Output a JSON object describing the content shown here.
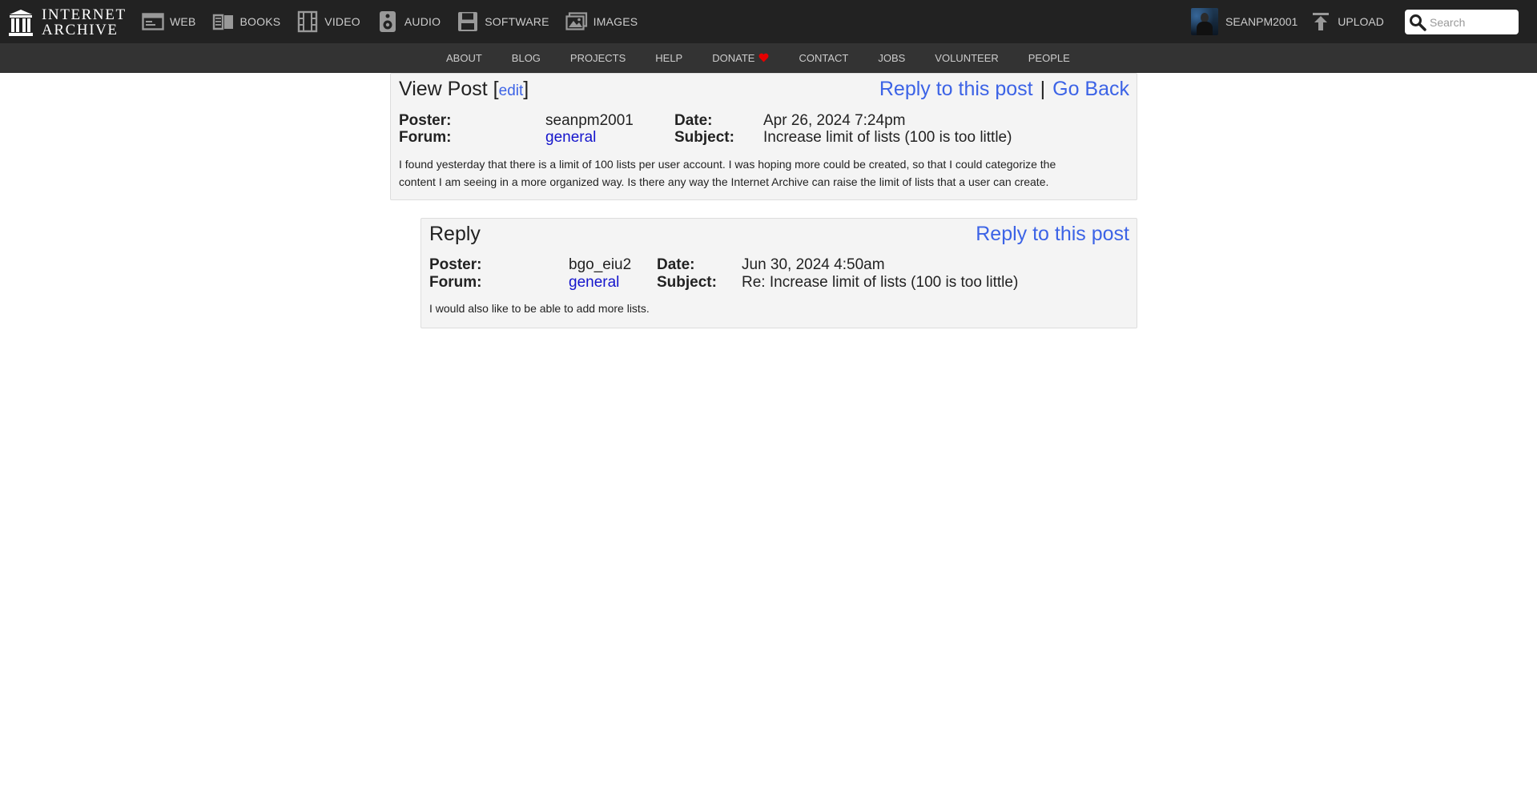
{
  "header": {
    "logo_line1": "INTERNET",
    "logo_line2": "ARCHIVE",
    "media_items": [
      {
        "label": "WEB",
        "icon": "web-icon"
      },
      {
        "label": "BOOKS",
        "icon": "books-icon"
      },
      {
        "label": "VIDEO",
        "icon": "video-icon"
      },
      {
        "label": "AUDIO",
        "icon": "audio-icon"
      },
      {
        "label": "SOFTWARE",
        "icon": "software-icon"
      },
      {
        "label": "IMAGES",
        "icon": "images-icon"
      }
    ],
    "username": "SEANPM2001",
    "upload_label": "UPLOAD",
    "search_placeholder": "Search"
  },
  "subnav": {
    "items": [
      "ABOUT",
      "BLOG",
      "PROJECTS",
      "HELP",
      "DONATE",
      "CONTACT",
      "JOBS",
      "VOLUNTEER",
      "PEOPLE"
    ],
    "donate_icon": "heart-icon",
    "heart_color": "#e50000"
  },
  "post": {
    "title": "View Post",
    "edit_label": "edit",
    "reply_link": "Reply to this post",
    "separator": "|",
    "back_link": "Go Back",
    "poster_label": "Poster:",
    "poster": "seanpm2001",
    "forum_label": "Forum:",
    "forum": "general",
    "date_label": "Date:",
    "date": "Apr 26, 2024 7:24pm",
    "subject_label": "Subject:",
    "subject": "Increase limit of lists (100 is too little)",
    "body_line1": "I found yesterday that there is a limit of 100 lists per user account. I was hoping more could be created, so that I could categorize the",
    "body_line2": "content I am seeing in a more organized way. Is there any way the Internet Archive can raise the limit of lists that a user can create."
  },
  "reply": {
    "title": "Reply",
    "reply_link": "Reply to this post",
    "poster_label": "Poster:",
    "poster": "bgo_eiu2",
    "forum_label": "Forum:",
    "forum": "general",
    "date_label": "Date:",
    "date": "Jun 30, 2024 4:50am",
    "subject_label": "Subject:",
    "subject": "Re: Increase limit of lists (100 is too little)",
    "body": "I would also like to be able to add more lists."
  },
  "colors": {
    "topbar": "#222222",
    "subnav": "#333333",
    "link_blue": "#3c63e6",
    "forum_link": "#1515cc",
    "post_bg": "#f4f4f4"
  }
}
